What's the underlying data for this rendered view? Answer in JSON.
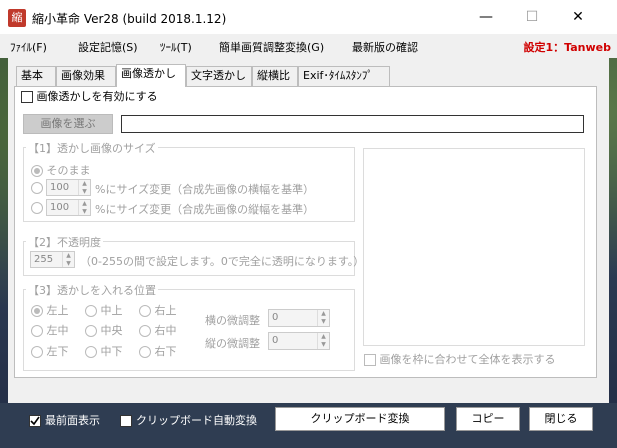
{
  "window": {
    "icon_glyph": "縮",
    "title": "縮小革命 Ver28  (build 2018.1.12)",
    "minimize_glyph": "—",
    "maximize_glyph": "☐",
    "close_glyph": "✕"
  },
  "menu": {
    "items": [
      "ﾌｧｲﾙ(F)",
      "設定記憶(S)",
      "ﾂｰﾙ(T)",
      "簡単画質調整変換(G)",
      "最新版の確認"
    ],
    "right_label": "設定1：Tanweb",
    "right_color": "#d00000"
  },
  "tabs": [
    "基本",
    "画像効果",
    "画像透かし",
    "文字透かし",
    "縦横比",
    "Exif･ﾀｲﾑｽﾀﾝﾌﾟ"
  ],
  "active_tab": "画像透かし",
  "watermark": {
    "enable_label": "画像透かしを有効にする",
    "enable_checked": false,
    "choose_image_button": "画像を選ぶ",
    "image_path": "",
    "size_group": {
      "title": "【1】透かし画像のサイズ",
      "option_as_is": "そのまま",
      "width_value": "100",
      "width_label": "%にサイズ変更（合成先画像の横幅を基準）",
      "height_value": "100",
      "height_label": "%にサイズ変更（合成先画像の縦幅を基準）"
    },
    "opacity_group": {
      "title": "【2】不透明度",
      "value": "255",
      "description": "（0-255の間で設定します。0で完全に透明になります。）"
    },
    "position_group": {
      "title": "【3】透かしを入れる位置",
      "positions": [
        "左上",
        "中上",
        "右上",
        "左中",
        "中央",
        "右中",
        "左下",
        "中下",
        "右下"
      ],
      "selected": "左上",
      "h_adjust_label": "横の微調整",
      "h_adjust_value": "0",
      "v_adjust_label": "縦の微調整",
      "v_adjust_value": "0"
    },
    "fit_preview_label": "画像を枠に合わせて全体を表示する"
  },
  "bottom": {
    "always_on_top_label": "最前面表示",
    "always_on_top_checked": true,
    "clipboard_auto_label": "クリップボード自動変換",
    "clipboard_auto_checked": false,
    "clipboard_convert_button": "クリップボード変換",
    "copy_button": "コピー",
    "close_button": "閉じる"
  }
}
